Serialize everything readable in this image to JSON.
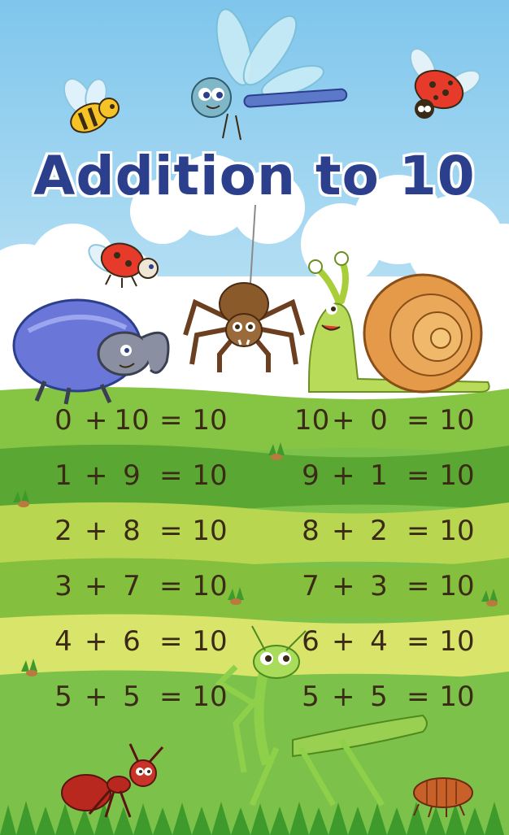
{
  "title": "Addition to 10",
  "equations": {
    "left": [
      {
        "a": "0",
        "op": "+",
        "b": "10",
        "eq": "=",
        "sum": "10"
      },
      {
        "a": "1",
        "op": "+",
        "b": "9",
        "eq": "=",
        "sum": "10"
      },
      {
        "a": "2",
        "op": "+",
        "b": "8",
        "eq": "=",
        "sum": "10"
      },
      {
        "a": "3",
        "op": "+",
        "b": "7",
        "eq": "=",
        "sum": "10"
      },
      {
        "a": "4",
        "op": "+",
        "b": "6",
        "eq": "=",
        "sum": "10"
      },
      {
        "a": "5",
        "op": "+",
        "b": "5",
        "eq": "=",
        "sum": "10"
      }
    ],
    "right": [
      {
        "a": "10",
        "op": "+",
        "b": "0",
        "eq": "=",
        "sum": "10"
      },
      {
        "a": "9",
        "op": "+",
        "b": "1",
        "eq": "=",
        "sum": "10"
      },
      {
        "a": "8",
        "op": "+",
        "b": "2",
        "eq": "=",
        "sum": "10"
      },
      {
        "a": "7",
        "op": "+",
        "b": "3",
        "eq": "=",
        "sum": "10"
      },
      {
        "a": "6",
        "op": "+",
        "b": "4",
        "eq": "=",
        "sum": "10"
      },
      {
        "a": "5",
        "op": "+",
        "b": "5",
        "eq": "=",
        "sum": "10"
      }
    ]
  },
  "illustrations": [
    "bee-icon",
    "dragonfly-icon",
    "ladybug-icon",
    "beetle-icon",
    "spider-icon",
    "snail-icon",
    "mantis-icon",
    "ant-icon",
    "pillbug-icon"
  ],
  "colors": {
    "sky": "#8fcfee",
    "grass_dark": "#5aa833",
    "grass_light": "#d9e56a",
    "title": "#2b3f8c",
    "numbers": "#3a2a16"
  }
}
